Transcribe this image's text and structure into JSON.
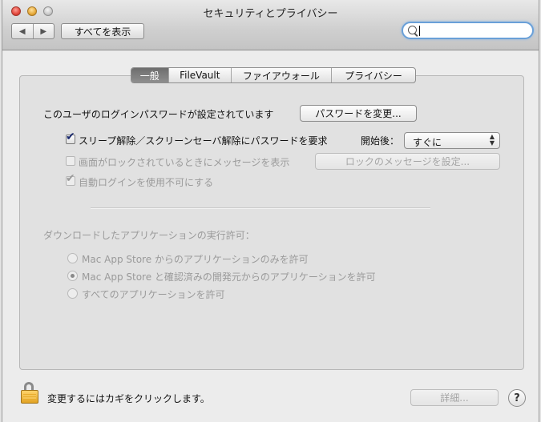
{
  "window": {
    "title": "セキュリティとプライバシー"
  },
  "toolbar": {
    "back_glyph": "◀",
    "forward_glyph": "▶",
    "show_all": "すべてを表示",
    "search_placeholder": ""
  },
  "tabs": [
    {
      "label": "一般",
      "selected": true
    },
    {
      "label": "FileVault",
      "selected": false
    },
    {
      "label": "ファイアウォール",
      "selected": false
    },
    {
      "label": "プライバシー",
      "selected": false
    }
  ],
  "general": {
    "password_set_text": "このユーザのログインパスワードが設定されています",
    "change_password_button": "パスワードを変更...",
    "require_password_label": "スリープ解除／スクリーンセーバ解除にパスワードを要求",
    "require_password_checked": true,
    "after_label": "開始後：",
    "after_value": "すぐに",
    "show_message_label": "画面がロックされているときにメッセージを表示",
    "show_message_checked": false,
    "set_lock_message_button": "ロックのメッセージを設定...",
    "disable_autologin_label": "自動ログインを使用不可にする",
    "disable_autologin_checked": true,
    "download_heading": "ダウンロードしたアプリケーションの実行許可：",
    "options": [
      {
        "label": "Mac App Store からのアプリケーションのみを許可",
        "selected": false
      },
      {
        "label": "Mac App Store と確認済みの開発元からのアプリケーションを許可",
        "selected": true
      },
      {
        "label": "すべてのアプリケーションを許可",
        "selected": false
      }
    ]
  },
  "footer": {
    "lock_text": "変更するにはカギをクリックします。",
    "advanced_button": "詳細...",
    "help_glyph": "?"
  },
  "glyphs": {
    "check": "✔",
    "popup_up": "▲",
    "popup_down": "▼"
  },
  "colors": {
    "search_focus": "#6aa0d8",
    "selected_tab": "#7a7a7a",
    "lock": "#e2a323"
  }
}
